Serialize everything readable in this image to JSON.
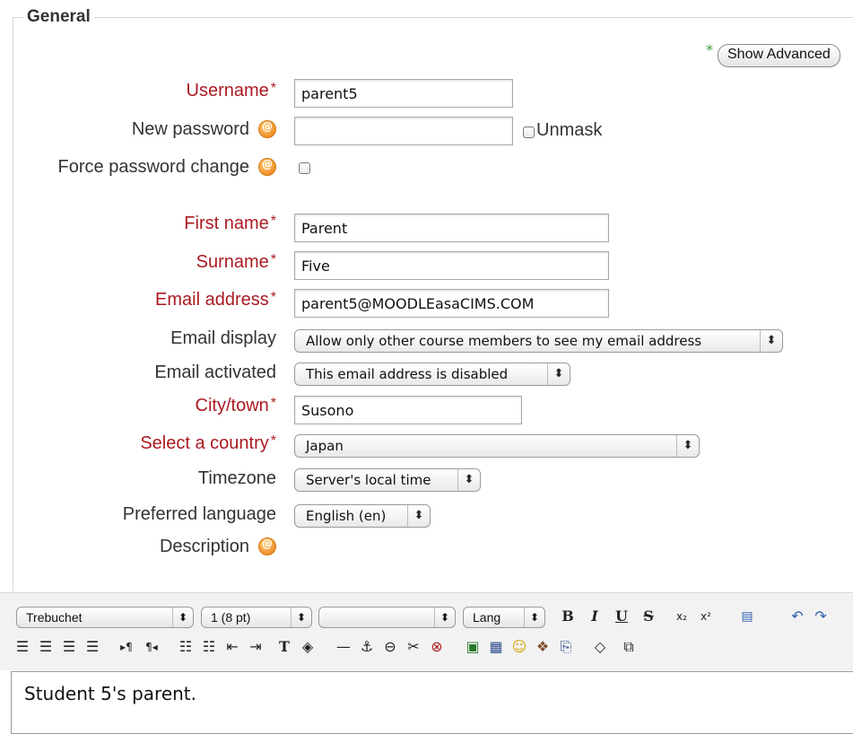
{
  "section": {
    "legend": "General"
  },
  "show_advanced": {
    "star": "*",
    "label": "Show Advanced"
  },
  "required_mark": "*",
  "fields": {
    "username": {
      "label": "Username",
      "value": "parent5"
    },
    "new_password": {
      "label": "New password",
      "value": ""
    },
    "unmask": {
      "label": "Unmask"
    },
    "force_password_change": {
      "label": "Force password change"
    },
    "first_name": {
      "label": "First name",
      "value": "Parent"
    },
    "surname": {
      "label": "Surname",
      "value": "Five"
    },
    "email": {
      "label": "Email address",
      "value": "parent5@MOODLEasaCIMS.COM"
    },
    "email_display": {
      "label": "Email display",
      "value": "Allow only other course members to see my email address"
    },
    "email_activated": {
      "label": "Email activated",
      "value": "This email address is disabled"
    },
    "city": {
      "label": "City/town",
      "value": "Susono"
    },
    "country": {
      "label": "Select a country",
      "value": "Japan"
    },
    "timezone": {
      "label": "Timezone",
      "value": "Server's local time"
    },
    "language": {
      "label": "Preferred language",
      "value": "English (en)"
    },
    "description": {
      "label": "Description"
    }
  },
  "editor": {
    "font_family": "Trebuchet",
    "font_size": "1 (8 pt)",
    "heading": "",
    "lang": "Lang",
    "content": "Student 5's parent."
  },
  "icons": {
    "select_arrows": "⬍",
    "help": "help-icon"
  }
}
